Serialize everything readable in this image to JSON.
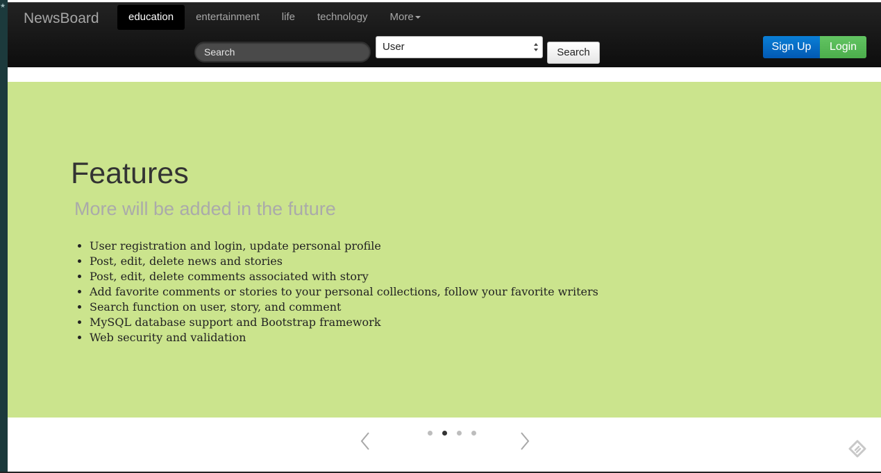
{
  "app": {
    "brand": "NewsBoard"
  },
  "nav": {
    "items": [
      {
        "label": "education",
        "active": true
      },
      {
        "label": "entertainment",
        "active": false
      },
      {
        "label": "life",
        "active": false
      },
      {
        "label": "technology",
        "active": false
      },
      {
        "label": "More",
        "active": false,
        "dropdown": true
      }
    ]
  },
  "search": {
    "placeholder": "Search",
    "type_selected": "User",
    "button_label": "Search"
  },
  "auth": {
    "signup_label": "Sign Up",
    "login_label": "Login"
  },
  "hero": {
    "title": "Features",
    "subtitle": "More will be added in the future",
    "features": [
      "User registration and login, update personal profile",
      "Post, edit, delete news and stories",
      "Post, edit, delete comments associated with story",
      "Add favorite comments or stories to your personal collections, follow your favorite writers",
      "Search function on user, story, and comment",
      "MySQL database support and Bootstrap framework",
      "Web security and validation"
    ]
  },
  "carousel": {
    "slide_count": 4,
    "active_index": 1
  },
  "colors": {
    "hero_background": "#cbe48d",
    "navbar_background": "#111111",
    "signup_blue": "#0a6fd0",
    "login_green": "#5cb85c"
  },
  "icons": {
    "prev": "chevron-left-icon",
    "next": "chevron-right-icon",
    "corner": "feedly-icon",
    "select_arrows": "up-down-arrows-icon"
  }
}
